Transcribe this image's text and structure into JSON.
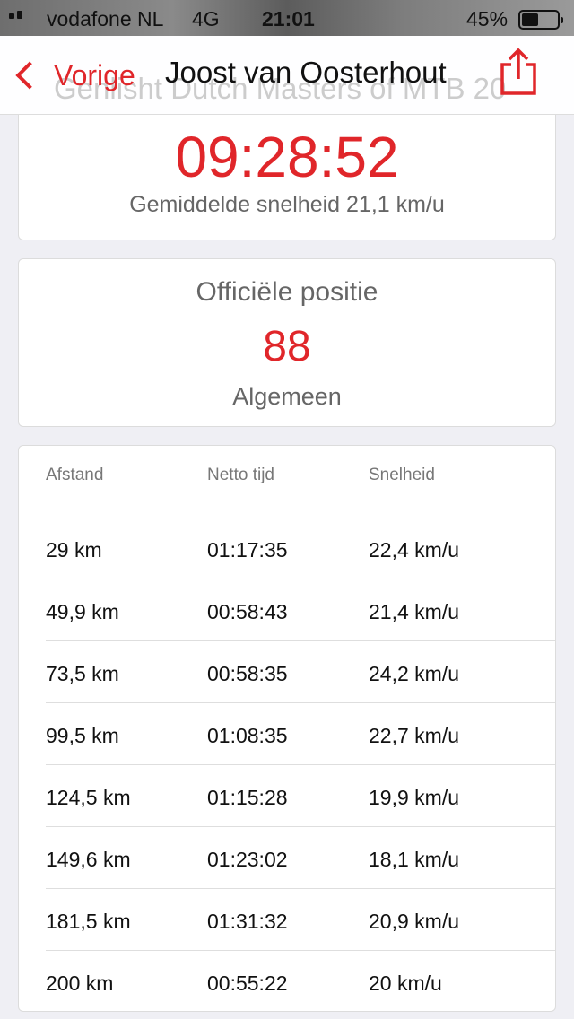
{
  "status_bar": {
    "carrier": "vodafone NL",
    "network": "4G",
    "time": "21:01",
    "battery_percent": "45%",
    "battery_level": 0.45
  },
  "nav": {
    "back_label": "Vorige",
    "title": "Joost van Oosterhout",
    "behind_title": "Genlisht Dutch Masters of MTB 20",
    "accent_color": "#e0262a"
  },
  "result": {
    "total_time": "09:28:52",
    "avg_speed": "Gemiddelde snelheid 21,1 km/u"
  },
  "position": {
    "heading": "Officiële positie",
    "value": "88",
    "label": "Algemeen"
  },
  "splits": {
    "headers": [
      "Afstand",
      "Netto tijd",
      "Snelheid"
    ],
    "rows": [
      [
        "29 km",
        "01:17:35",
        "22,4 km/u"
      ],
      [
        "49,9 km",
        "00:58:43",
        "21,4 km/u"
      ],
      [
        "73,5 km",
        "00:58:35",
        "24,2 km/u"
      ],
      [
        "99,5 km",
        "01:08:35",
        "22,7 km/u"
      ],
      [
        "124,5 km",
        "01:15:28",
        "19,9 km/u"
      ],
      [
        "149,6 km",
        "01:23:02",
        "18,1 km/u"
      ],
      [
        "181,5 km",
        "01:31:32",
        "20,9 km/u"
      ],
      [
        "200 km",
        "00:55:22",
        "20 km/u"
      ]
    ]
  },
  "icons": {
    "back": "chevron-left-icon",
    "share": "share-icon"
  }
}
